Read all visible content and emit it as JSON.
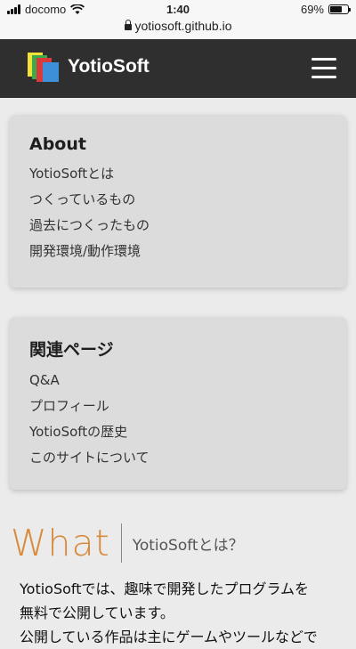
{
  "status_bar": {
    "carrier": "docomo",
    "time": "1:40",
    "battery": "69%",
    "battery_level": 0.69,
    "url": "yotiosoft.github.io"
  },
  "nav": {
    "brand": "YotioSoft",
    "logo_icon": "yotiosoft-logo",
    "menu_icon": "hamburger-menu-icon"
  },
  "about": {
    "title": "About",
    "links": [
      "YotioSoftとは",
      "つくっているもの",
      "過去につくったもの",
      "開発環境/動作環境"
    ]
  },
  "related": {
    "title": "関連ページ",
    "links": [
      "Q&A",
      "プロフィール",
      "YotioSoftの歴史",
      "このサイトについて"
    ]
  },
  "section": {
    "heading_big": "What",
    "heading_sub": "YotioSoftとは？",
    "text_line1": "YotioSoftでは、趣味で開発したプログラムを",
    "text_line2": "無料で公開しています。",
    "text_line3": "公開している作品は主にゲームやツールなどで"
  },
  "colors": {
    "nav_bg": "#2f2f2f",
    "accent": "#d88a3b",
    "card_bg": "#dcdcdc",
    "page_bg": "#ebebeb"
  }
}
